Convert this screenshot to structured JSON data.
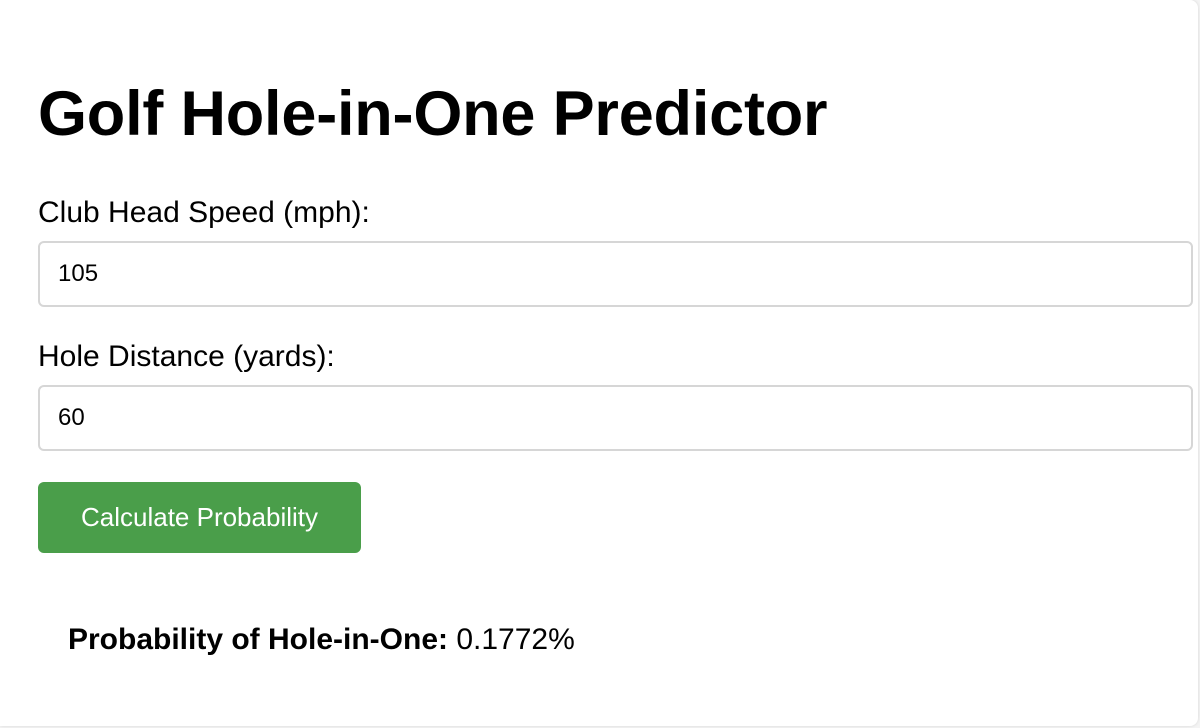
{
  "page": {
    "title": "Golf Hole-in-One Predictor"
  },
  "form": {
    "club_speed_label": "Club Head Speed (mph):",
    "club_speed_value": "105",
    "hole_distance_label": "Hole Distance (yards):",
    "hole_distance_value": "60",
    "calculate_label": "Calculate Probability"
  },
  "result": {
    "label": "Probability of Hole-in-One:",
    "value": "0.1772%"
  },
  "colors": {
    "button_background": "#4a9e4a",
    "button_text": "#ffffff",
    "input_border": "#d6d6d6"
  }
}
